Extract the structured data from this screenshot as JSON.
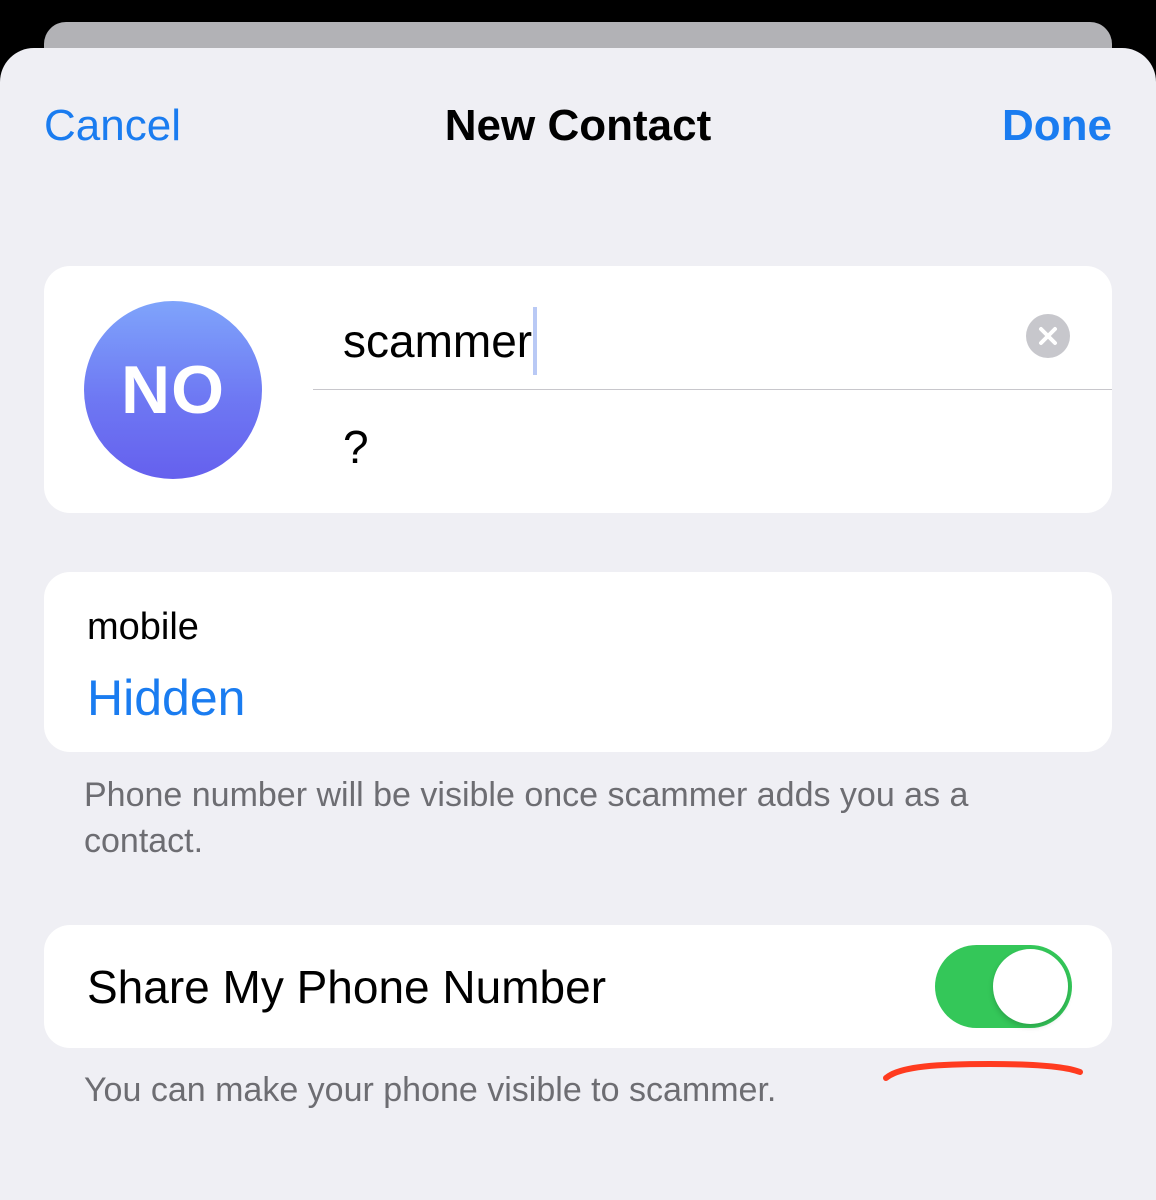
{
  "nav": {
    "cancel_label": "Cancel",
    "title": "New Contact",
    "done_label": "Done"
  },
  "contact": {
    "avatar_initials": "NO",
    "first_name": "scammer",
    "second_field": "?"
  },
  "phone": {
    "label": "mobile",
    "value": "Hidden",
    "footer": "Phone number will be visible once scammer adds you as a contact."
  },
  "share": {
    "label": "Share My Phone Number",
    "enabled": true,
    "footer": "You can make your phone visible to scammer."
  },
  "colors": {
    "accent": "#1a7cf0",
    "toggle_on": "#34c759",
    "background": "#efeff4",
    "annotation": "#ff3b1f"
  },
  "icons": {
    "clear": "clear-circle-x-icon"
  }
}
